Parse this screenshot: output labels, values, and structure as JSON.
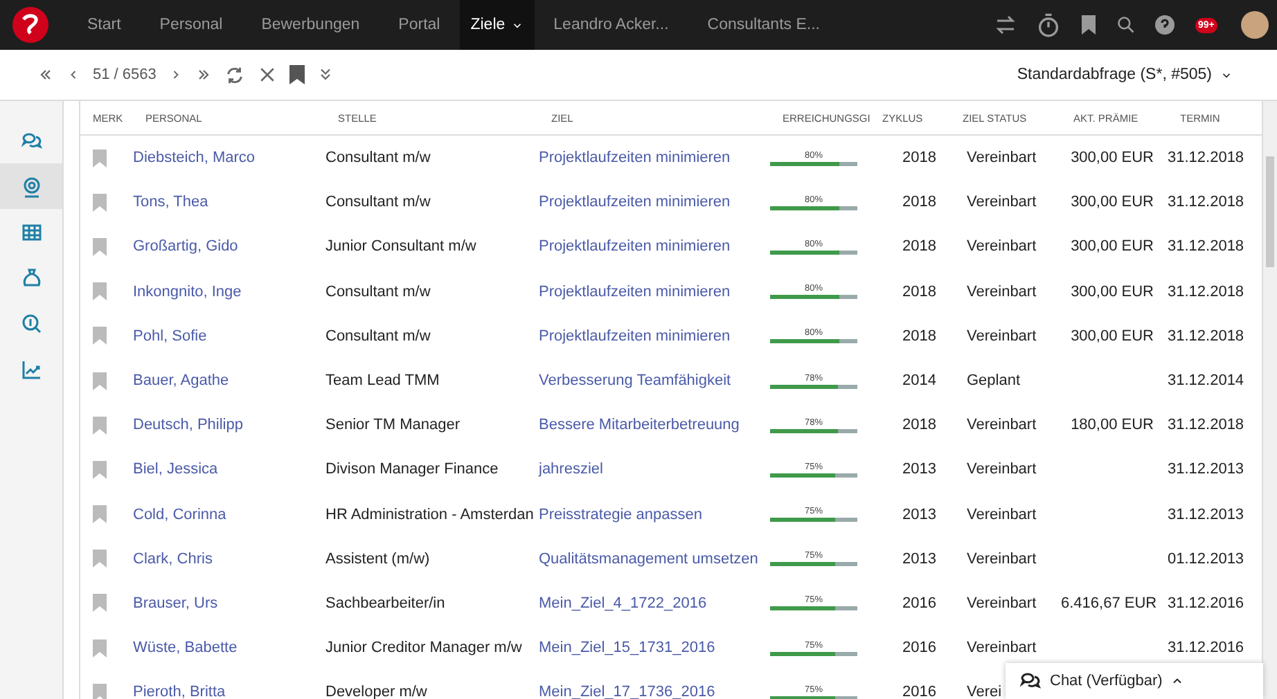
{
  "top_nav": {
    "items": [
      {
        "label": "Start",
        "selected": false
      },
      {
        "label": "Personal",
        "selected": false
      },
      {
        "label": "Bewerbungen",
        "selected": false
      },
      {
        "label": "Portal",
        "selected": false
      },
      {
        "label": "Ziele",
        "selected": true,
        "dropdown": true
      },
      {
        "label": "Leandro Acker...",
        "selected": false
      },
      {
        "label": "Consultants E...",
        "selected": false
      }
    ],
    "notification_badge": "99+"
  },
  "toolbar": {
    "position": "51 / 6563",
    "query": "Standardabfrage (S*, #505)"
  },
  "sidebar": {
    "items": [
      {
        "kind": "chat",
        "selected": false
      },
      {
        "kind": "target",
        "selected": true
      },
      {
        "kind": "grid",
        "selected": false
      },
      {
        "kind": "bag",
        "selected": false
      },
      {
        "kind": "money-search",
        "selected": false
      },
      {
        "kind": "chart",
        "selected": false
      }
    ]
  },
  "table": {
    "columns": [
      "MERK",
      "PERSONAL",
      "STELLE",
      "ZIEL",
      "ERREICHUNGSGI",
      "ZYKLUS",
      "ZIEL STATUS",
      "AKT. PRÄMIE",
      "TERMIN"
    ],
    "rows": [
      {
        "personal": "Diebsteich, Marco",
        "stelle": "Consultant m/w",
        "ziel": "Projektlaufzeiten minimieren",
        "percent": "80%",
        "level": 0.8,
        "zyklus": "2018",
        "status": "Vereinbart",
        "praemie": "300,00 EUR",
        "termin": "31.12.2018"
      },
      {
        "personal": "Tons, Thea",
        "stelle": "Consultant m/w",
        "ziel": "Projektlaufzeiten minimieren",
        "percent": "80%",
        "level": 0.8,
        "zyklus": "2018",
        "status": "Vereinbart",
        "praemie": "300,00 EUR",
        "termin": "31.12.2018"
      },
      {
        "personal": "Großartig, Gido",
        "stelle": "Junior Consultant m/w",
        "ziel": "Projektlaufzeiten minimieren",
        "percent": "80%",
        "level": 0.8,
        "zyklus": "2018",
        "status": "Vereinbart",
        "praemie": "300,00 EUR",
        "termin": "31.12.2018"
      },
      {
        "personal": "Inkongnito, Inge",
        "stelle": "Consultant m/w",
        "ziel": "Projektlaufzeiten minimieren",
        "percent": "80%",
        "level": 0.8,
        "zyklus": "2018",
        "status": "Vereinbart",
        "praemie": "300,00 EUR",
        "termin": "31.12.2018"
      },
      {
        "personal": "Pohl, Sofie",
        "stelle": "Consultant m/w",
        "ziel": "Projektlaufzeiten minimieren",
        "percent": "80%",
        "level": 0.8,
        "zyklus": "2018",
        "status": "Vereinbart",
        "praemie": "300,00 EUR",
        "termin": "31.12.2018"
      },
      {
        "personal": "Bauer, Agathe",
        "stelle": "Team Lead TMM",
        "ziel": "Verbesserung Teamfähigkeit",
        "percent": "78%",
        "level": 0.78,
        "zyklus": "2014",
        "status": "Geplant",
        "termin": "31.12.2014"
      },
      {
        "personal": "Deutsch, Philipp",
        "stelle": "Senior TM Manager",
        "ziel": "Bessere Mitarbeiterbetreuung",
        "percent": "78%",
        "level": 0.78,
        "zyklus": "2018",
        "status": "Vereinbart",
        "praemie": "180,00 EUR",
        "termin": "31.12.2018"
      },
      {
        "personal": "Biel, Jessica",
        "stelle": "Divison Manager Finance",
        "ziel": "jahresziel",
        "percent": "75%",
        "level": 0.75,
        "zyklus": "2013",
        "status": "Vereinbart",
        "termin": "31.12.2013"
      },
      {
        "personal": "Cold, Corinna",
        "stelle": "HR Administration - Amsterdan",
        "ziel": "Preisstrategie anpassen",
        "percent": "75%",
        "level": 0.75,
        "zyklus": "2013",
        "status": "Vereinbart",
        "termin": "31.12.2013"
      },
      {
        "personal": "Clark, Chris",
        "stelle": "Assistent (m/w)",
        "ziel": "Qualitätsmanagement umsetzen",
        "percent": "75%",
        "level": 0.75,
        "zyklus": "2013",
        "status": "Vereinbart",
        "termin": "01.12.2013"
      },
      {
        "personal": "Brauser, Urs",
        "stelle": "Sachbearbeiter/in",
        "ziel": "Mein_Ziel_4_1722_2016",
        "percent": "75%",
        "level": 0.75,
        "zyklus": "2016",
        "status": "Vereinbart",
        "praemie": "6.416,67 EUR",
        "termin": "31.12.2016"
      },
      {
        "personal": "Wüste, Babette",
        "stelle": "Junior Creditor Manager m/w",
        "ziel": "Mein_Ziel_15_1731_2016",
        "percent": "75%",
        "level": 0.75,
        "zyklus": "2016",
        "status": "Vereinbart",
        "termin": "31.12.2016"
      },
      {
        "personal": "Pieroth, Britta",
        "stelle": "Developer m/w",
        "ziel": "Mein_Ziel_17_1736_2016",
        "percent": "75%",
        "level": 0.75,
        "zyklus": "2016",
        "status": "Verei"
      }
    ]
  },
  "chat": {
    "label": "Chat (Verfügbar)"
  }
}
